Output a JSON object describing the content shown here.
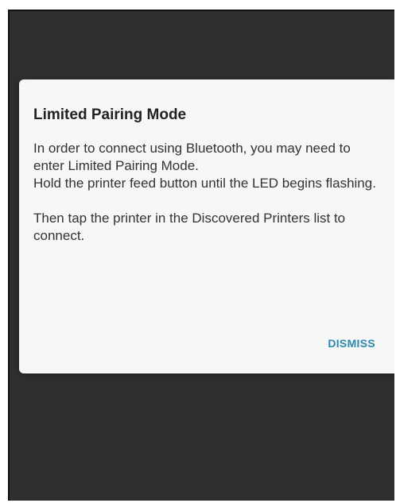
{
  "dialog": {
    "title": "Limited Pairing Mode",
    "paragraph_1": "In order to connect using Bluetooth, you may need to enter Limited Pairing Mode.\nHold the printer feed button until the LED begins flashing.",
    "paragraph_2": "Then tap the printer in the Discovered Printers list to connect.",
    "dismiss_label": "DISMISS"
  },
  "colors": {
    "scrim": "#2f2f2f",
    "dialog_background": "#f7f7f7",
    "accent": "#2a8ab0"
  }
}
